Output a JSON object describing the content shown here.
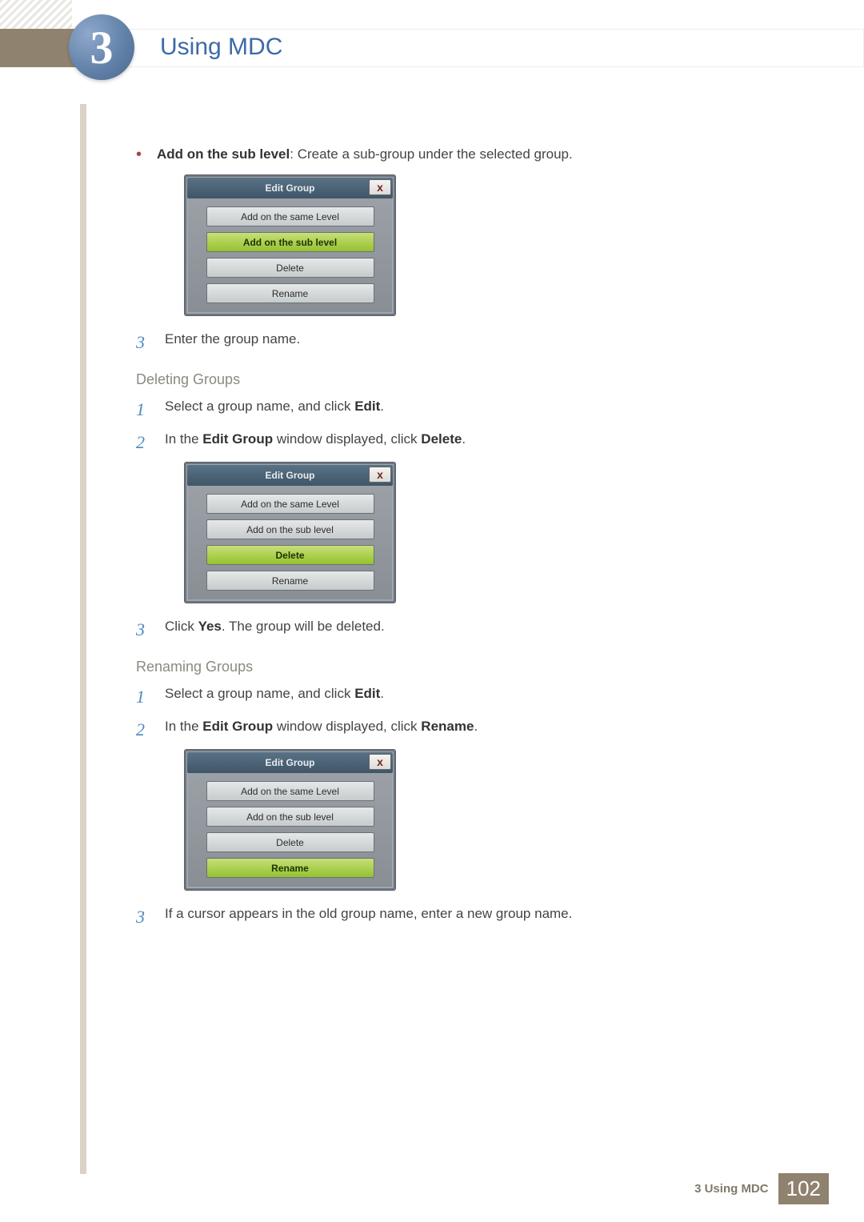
{
  "chapter": {
    "number": "3",
    "title": "Using MDC"
  },
  "body": {
    "bullet1_bold": "Add on the sub level",
    "bullet1_rest": ": Create a sub-group under the selected group.",
    "step3a": "Enter the group name.",
    "subhead_delete": "Deleting Groups",
    "del_step1_pre": "Select a group name, and click ",
    "del_step1_bold": "Edit",
    "del_step1_post": ".",
    "del_step2_pre": "In the ",
    "del_step2_b1": "Edit Group",
    "del_step2_mid": " window displayed, click ",
    "del_step2_b2": "Delete",
    "del_step2_post": ".",
    "del_step3_pre": "Click ",
    "del_step3_bold": "Yes",
    "del_step3_post": ". The group will be deleted.",
    "subhead_rename": "Renaming Groups",
    "ren_step1_pre": "Select a group name, and click ",
    "ren_step1_bold": "Edit",
    "ren_step1_post": ".",
    "ren_step2_pre": "In the ",
    "ren_step2_b1": "Edit Group",
    "ren_step2_mid": " window displayed, click ",
    "ren_step2_b2": "Rename",
    "ren_step2_post": ".",
    "ren_step3": "If a cursor appears in the old group name, enter a new group name."
  },
  "dialog": {
    "title": "Edit Group",
    "close": "x",
    "btn_same": "Add on the same Level",
    "btn_sub": "Add on the sub level",
    "btn_delete": "Delete",
    "btn_rename": "Rename"
  },
  "footer": {
    "label": "3 Using MDC",
    "page": "102"
  },
  "nums": {
    "n1": "1",
    "n2": "2",
    "n3": "3"
  }
}
